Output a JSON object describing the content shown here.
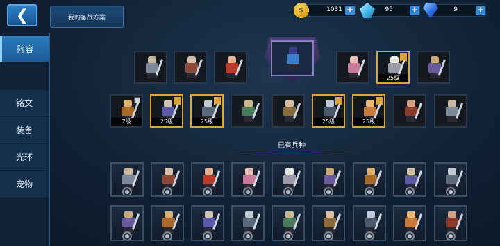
{
  "header": {
    "back_icon": "chevron-left-icon",
    "plan_label": "我的备战方案"
  },
  "resources": {
    "gold": "1031",
    "crystal": "95",
    "gem": "9",
    "plus_label": "+"
  },
  "sidebar": {
    "items": [
      {
        "label": "阵容",
        "active": true
      },
      {
        "label": "铭文",
        "active": false
      },
      {
        "label": "装备",
        "active": false
      },
      {
        "label": "光环",
        "active": false
      },
      {
        "label": "宠物",
        "active": false
      }
    ]
  },
  "lineup": {
    "row1_levels": [
      "",
      "",
      "",
      "",
      "25级",
      ""
    ],
    "row2_levels": [
      "7级",
      "25级",
      "25级",
      "",
      "",
      "25级",
      "25级",
      "",
      ""
    ]
  },
  "owned_section": {
    "title": "已有兵种"
  },
  "colors": {
    "accent": "#2a7bbf",
    "gold_border": "#d9a43a",
    "background": "#112236"
  }
}
